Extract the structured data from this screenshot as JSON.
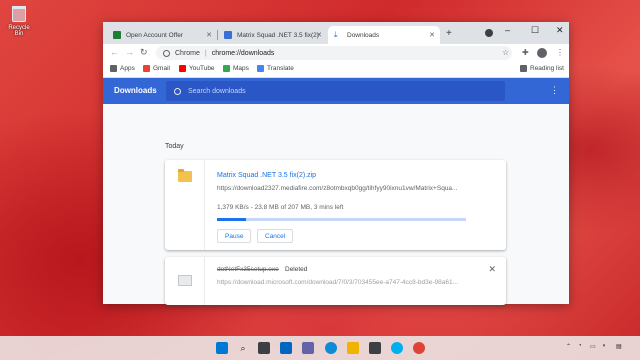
{
  "desktop": {
    "recycle_bin_label": "Recycle Bin"
  },
  "browser": {
    "tabs": [
      {
        "label": "Open Account Offer",
        "icon": "document-icon",
        "color": "#1e7e34"
      },
      {
        "label": "Matrix Squad .NET 3.5 fix(2)",
        "icon": "site-icon",
        "color": "#3b6fd6"
      },
      {
        "label": "Downloads",
        "icon": "download-icon",
        "color": "#1a73e8",
        "active": true
      }
    ],
    "address": {
      "scheme_label": "Chrome",
      "separator": "|",
      "url": "chrome://downloads"
    },
    "bookmarks": [
      {
        "label": "Apps",
        "icon": "apps-icon"
      },
      {
        "label": "Gmail",
        "icon": "gmail-icon",
        "color": "#ea4335"
      },
      {
        "label": "YouTube",
        "icon": "youtube-icon",
        "color": "#ff0000"
      },
      {
        "label": "Maps",
        "icon": "maps-icon",
        "color": "#34a853"
      },
      {
        "label": "Translate",
        "icon": "translate-icon",
        "color": "#4285f4"
      }
    ],
    "reading_list": "Reading list"
  },
  "downloads_page": {
    "title": "Downloads",
    "search_placeholder": "Search downloads",
    "section_label": "Today",
    "header_color": "#3367d6",
    "items": [
      {
        "filename": "Matrix Squad .NET 3.5 fix(2).zip",
        "url": "https://download2327.mediafire.com/z8otmbxqb0gg/tihfyy90ixnu1vw/Matrix+Squa...",
        "status": "1,379 KB/s - 23.8 MB of 207 MB, 3 mins left",
        "progress": 0.115,
        "buttons": [
          "Pause",
          "Cancel"
        ]
      },
      {
        "filename": "dotNetFx35setup.exe",
        "status": "Deleted",
        "url": "https://download.microsoft.com/download/7/0/3/703455ee-a747-4cc8-bd3e-98a61..."
      }
    ]
  },
  "taskbar": {
    "apps": [
      {
        "icon": "windows-start-icon",
        "color": "#0078d4"
      },
      {
        "icon": "search-icon",
        "color": "#202124"
      },
      {
        "icon": "task-view-icon",
        "color": "#202124"
      },
      {
        "icon": "widgets-icon",
        "color": "#0067c0"
      },
      {
        "icon": "chat-icon",
        "color": "#6264a7"
      },
      {
        "icon": "edge-icon",
        "color": "#0c8bd6"
      },
      {
        "icon": "explorer-icon",
        "color": "#f0b400"
      },
      {
        "icon": "store-icon",
        "color": "#202124"
      },
      {
        "icon": "skype-icon",
        "color": "#00aff0"
      },
      {
        "icon": "chrome-icon",
        "color": "#db4437"
      }
    ]
  }
}
